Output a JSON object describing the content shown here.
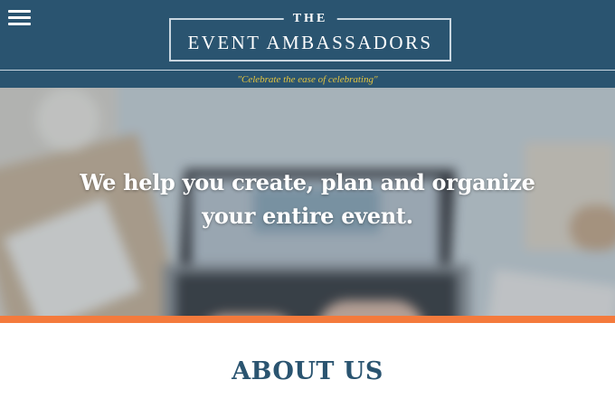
{
  "header": {
    "menu_icon": "hamburger-menu-icon",
    "logo_the": "THE",
    "logo_name": "EVENT AMBASSADORS",
    "tagline": "\"Celebrate the ease of celebrating\""
  },
  "hero": {
    "heading": "We help you create, plan and organize your entire event."
  },
  "about": {
    "title": "ABOUT US"
  },
  "colors": {
    "header_bg": "#2a5470",
    "tagline_text": "#e3c33f",
    "accent": "#f47a3c",
    "heading": "#2a5470"
  }
}
